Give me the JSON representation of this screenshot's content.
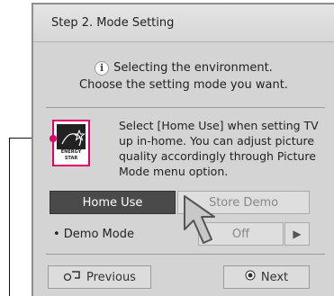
{
  "dialog": {
    "title": "Step 2. Mode Setting",
    "info_line1": "Selecting the environment.",
    "info_line2": "Choose the setting mode you want."
  },
  "energy_star": {
    "label": "ENERGY STAR"
  },
  "description": "Select [Home Use] when setting TV up in-home. You can adjust picture quality accordingly through Picture Mode menu option.",
  "mode_buttons": {
    "home_use": "Home Use",
    "store_demo": "Store Demo"
  },
  "demo_mode": {
    "label": "• Demo Mode",
    "value": "Off"
  },
  "nav": {
    "previous": "Previous",
    "next": "Next"
  },
  "colors": {
    "accent": "#e1006a",
    "selected_button": "#4a4a4a"
  },
  "icons": {
    "info": "info-icon",
    "previous": "previous-icon",
    "next": "radio-dot-icon",
    "arrow_right": "arrow-right-icon",
    "cursor": "pointer-cursor-icon"
  }
}
